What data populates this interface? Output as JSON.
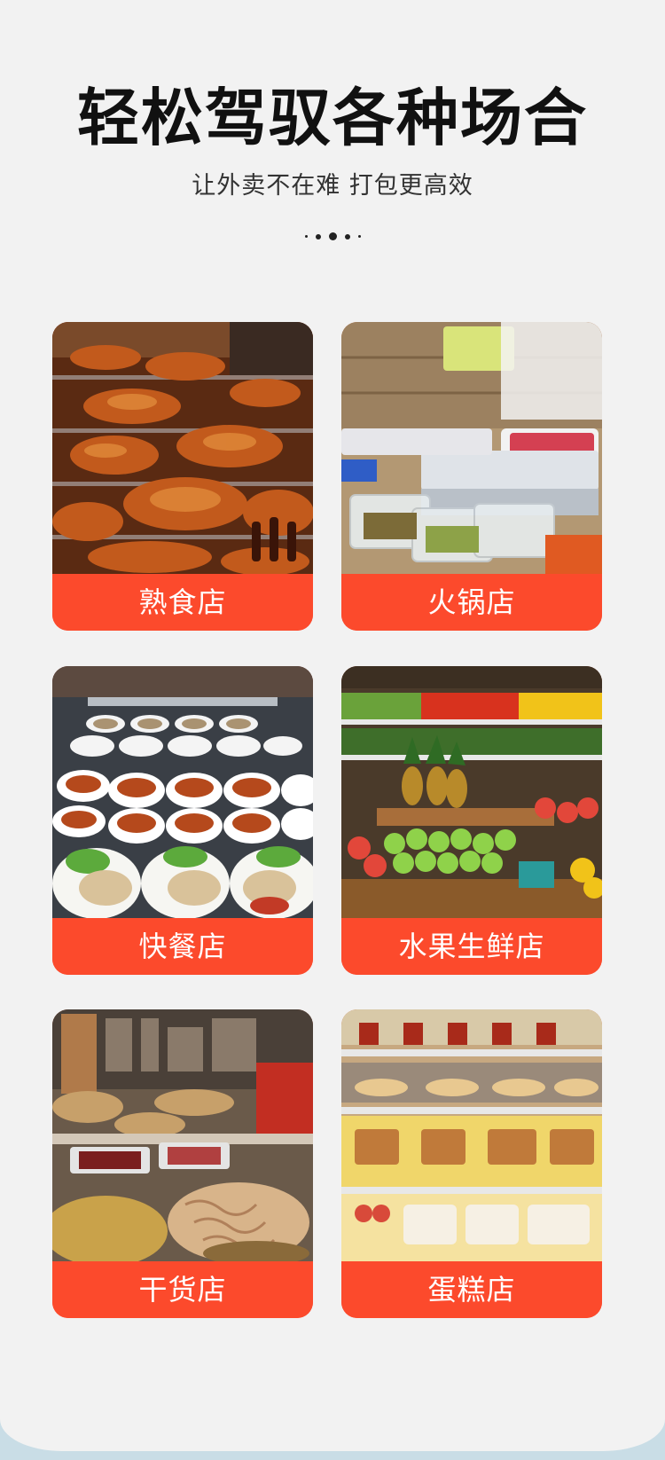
{
  "header": {
    "title": "轻松驾驭各种场合",
    "subtitle": "让外卖不在难 打包更高效"
  },
  "cards": [
    {
      "label": "熟食店",
      "image": "deli-photo"
    },
    {
      "label": "火锅店",
      "image": "hotpot-shop-photo"
    },
    {
      "label": "快餐店",
      "image": "fast-food-photo"
    },
    {
      "label": "水果生鲜店",
      "image": "fresh-fruit-shop-photo"
    },
    {
      "label": "干货店",
      "image": "dried-goods-shop-photo"
    },
    {
      "label": "蛋糕店",
      "image": "cake-shop-photo"
    }
  ],
  "colors": {
    "accent": "#fc4a2c",
    "background": "#f2f2f2",
    "bottom_strip": "#c9dde6"
  }
}
